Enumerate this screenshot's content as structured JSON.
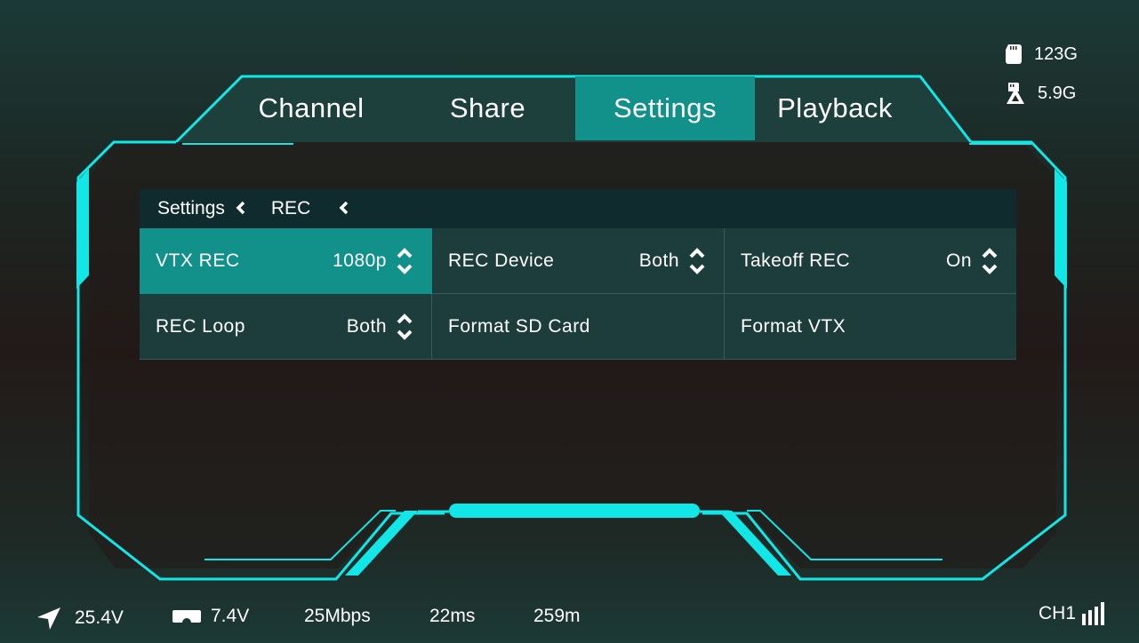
{
  "tabs": [
    {
      "label": "Channel",
      "active": false
    },
    {
      "label": "Share",
      "active": false
    },
    {
      "label": "Settings",
      "active": true
    },
    {
      "label": "Playback",
      "active": false
    }
  ],
  "storage": {
    "sd_icon": "sd-card-icon",
    "sd_value": "123G",
    "vtx_icon": "vtx-storage-icon",
    "vtx_value": "5.9G"
  },
  "breadcrumb": {
    "items": [
      {
        "label": "Settings",
        "chevron": "‹"
      },
      {
        "label": "REC",
        "chevron": "‹"
      }
    ]
  },
  "settings": [
    {
      "label": "VTX REC",
      "value": "1080p",
      "stepper": true,
      "active": true
    },
    {
      "label": "REC Device",
      "value": "Both",
      "stepper": true,
      "active": false
    },
    {
      "label": "Takeoff REC",
      "value": "On",
      "stepper": true,
      "active": false
    },
    {
      "label": "REC Loop",
      "value": "Both",
      "stepper": true,
      "active": false
    },
    {
      "label": "Format SD Card",
      "value": "",
      "stepper": false,
      "active": false
    },
    {
      "label": "Format VTX",
      "value": "",
      "stepper": false,
      "active": false
    }
  ],
  "status": {
    "drone_voltage": "25.4V",
    "goggles_voltage": "7.4V",
    "bitrate": "25Mbps",
    "latency": "22ms",
    "distance": "259m",
    "channel": "CH1"
  },
  "colors": {
    "accent": "#12e6e6",
    "active_cell": "#12908a",
    "cell_bg": "#1c3d3c",
    "breadcrumb_bg": "#0f2b2d"
  }
}
